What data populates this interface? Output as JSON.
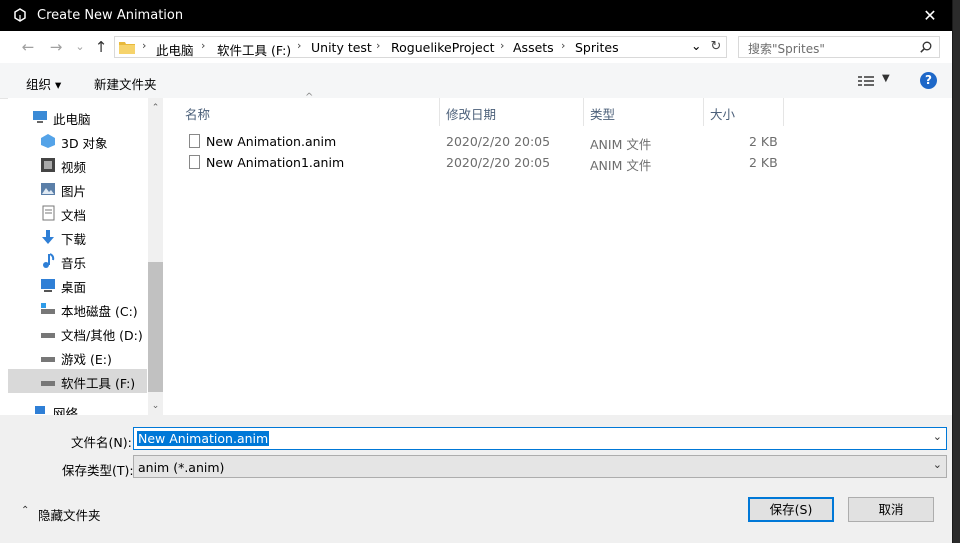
{
  "window": {
    "title": "Create New Animation",
    "close_glyph": "✕"
  },
  "nav": {
    "back_glyph": "←",
    "forward_glyph": "→",
    "dropdown_glyph": "⌄",
    "up_glyph": "↑",
    "breadcrumb": [
      "此电脑",
      "软件工具 (F:)",
      "Unity test",
      "RoguelikeProject",
      "Assets",
      "Sprites"
    ],
    "refresh_glyph": "↻",
    "search_placeholder": "搜索\"Sprites\""
  },
  "toolbar": {
    "organize": "组织 ▾",
    "new_folder": "新建文件夹",
    "help": "?"
  },
  "sidebar": {
    "items": [
      {
        "label": "此电脑",
        "icon": "computer-icon"
      },
      {
        "label": "3D 对象",
        "icon": "3d-objects-icon"
      },
      {
        "label": "视频",
        "icon": "video-icon"
      },
      {
        "label": "图片",
        "icon": "pictures-icon"
      },
      {
        "label": "文档",
        "icon": "documents-icon"
      },
      {
        "label": "下载",
        "icon": "download-icon"
      },
      {
        "label": "音乐",
        "icon": "music-icon"
      },
      {
        "label": "桌面",
        "icon": "desktop-icon"
      },
      {
        "label": "本地磁盘 (C:)",
        "icon": "drive-icon"
      },
      {
        "label": "文档/其他 (D:)",
        "icon": "drive-icon"
      },
      {
        "label": "游戏 (E:)",
        "icon": "drive-icon"
      },
      {
        "label": "软件工具 (F:)",
        "icon": "drive-icon",
        "selected": true
      },
      {
        "label": "网络",
        "icon": "network-icon"
      }
    ],
    "scroll_up": "⌃",
    "scroll_down": "⌄"
  },
  "columns": {
    "name": "名称",
    "modified": "修改日期",
    "type": "类型",
    "size": "大小",
    "sort_glyph": "^"
  },
  "files": [
    {
      "name": "New Animation.anim",
      "modified": "2020/2/20 20:05",
      "type": "ANIM 文件",
      "size": "2 KB"
    },
    {
      "name": "New Animation1.anim",
      "modified": "2020/2/20 20:05",
      "type": "ANIM 文件",
      "size": "2 KB"
    }
  ],
  "form": {
    "filename_label": "文件名(N):",
    "filename_value": "New Animation.anim",
    "filetype_label": "保存类型(T):",
    "filetype_value": "anim (*.anim)",
    "dropdown_glyph": "⌄"
  },
  "footer": {
    "hide_folders": "隐藏文件夹",
    "hide_glyph": "⌃",
    "save": "保存(S)",
    "cancel": "取消"
  },
  "colors": {
    "accent": "#0078d7",
    "selection": "#d9d9d9",
    "titlebar": "#000000"
  }
}
